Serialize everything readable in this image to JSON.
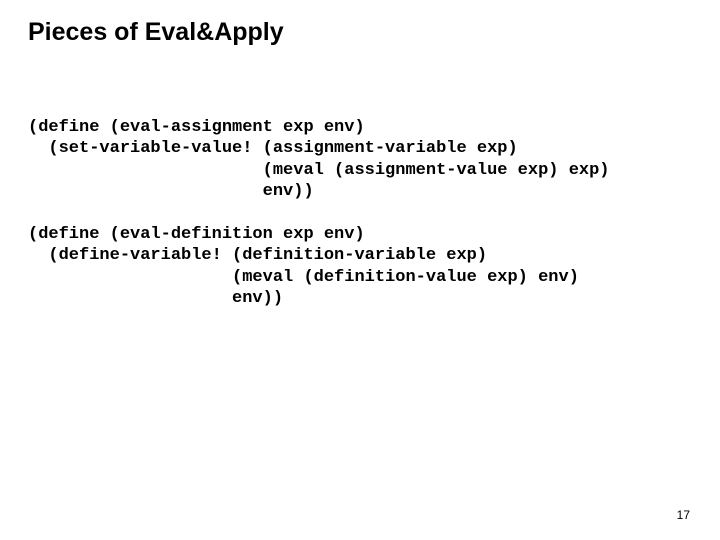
{
  "title": "Pieces of Eval&Apply",
  "code1": "(define (eval-assignment exp env)\n  (set-variable-value! (assignment-variable exp)\n                       (meval (assignment-value exp) exp)\n                       env))",
  "code2": "(define (eval-definition exp env)\n  (define-variable! (definition-variable exp)\n                    (meval (definition-value exp) env)\n                    env))",
  "pageNumber": "17"
}
